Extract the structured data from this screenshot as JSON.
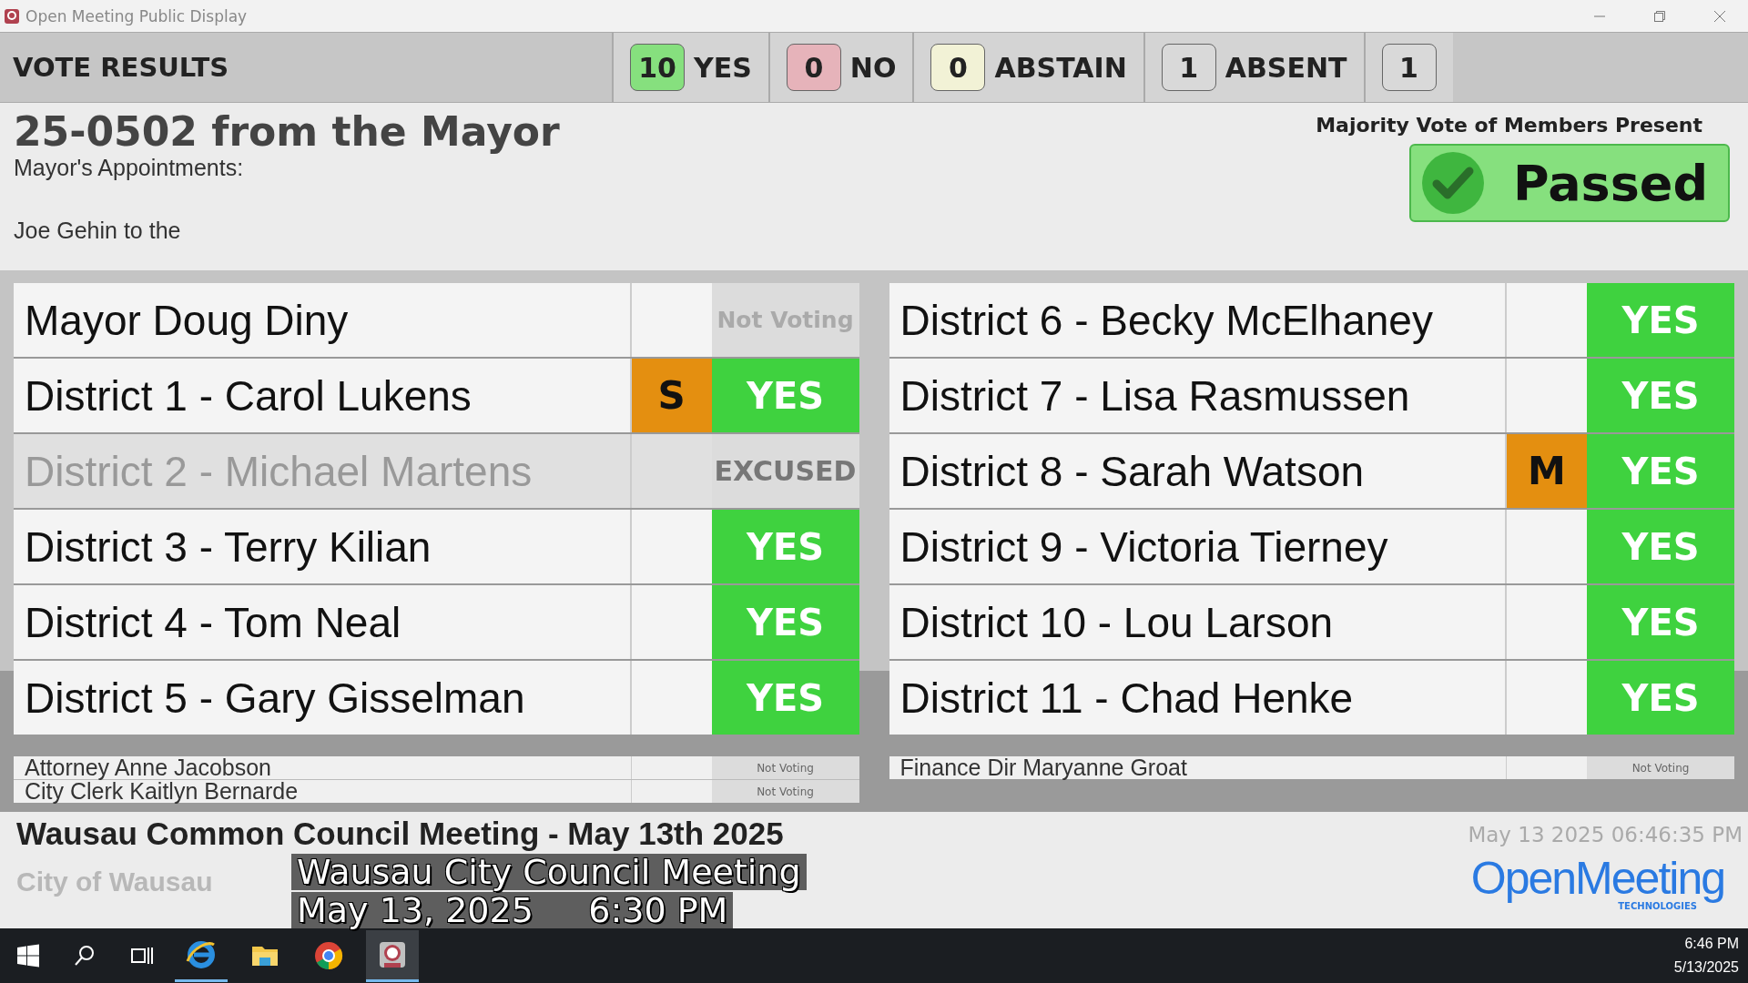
{
  "window": {
    "title": "Open Meeting Public Display"
  },
  "header": {
    "title": "VOTE RESULTS",
    "tallies": [
      {
        "count": "10",
        "label": "YES",
        "color": "#86e07e"
      },
      {
        "count": "0",
        "label": "NO",
        "color": "#e6b3ba"
      },
      {
        "count": "0",
        "label": "ABSTAIN",
        "color": "#f2f2d6"
      },
      {
        "count": "1",
        "label": "ABSENT",
        "color": "#d9d9d9"
      },
      {
        "count": "1",
        "color": "#d9d9d9"
      }
    ]
  },
  "item": {
    "number": "25-0502 from the Mayor",
    "lines": [
      "Mayor's Appointments:",
      "Joe Gehin to the"
    ],
    "rule": "Majority Vote of Members Present",
    "result": "Passed"
  },
  "columns": [
    [
      {
        "name": "Mayor Doug Diny",
        "vote": "Not Voting",
        "kind": "not_voting",
        "present": true
      },
      {
        "name": "District 1 - Carol Lukens",
        "role": "S",
        "vote": "YES",
        "kind": "yes",
        "present": true
      },
      {
        "name": "District 2 - Michael Martens",
        "vote": "EXCUSED",
        "kind": "excused",
        "present": false
      },
      {
        "name": "District 3 - Terry Kilian",
        "vote": "YES",
        "kind": "yes",
        "present": true
      },
      {
        "name": "District 4 - Tom Neal",
        "vote": "YES",
        "kind": "yes",
        "present": true
      },
      {
        "name": "District 5 - Gary Gisselman",
        "vote": "YES",
        "kind": "yes",
        "present": true
      }
    ],
    [
      {
        "name": "District 6 - Becky McElhaney",
        "vote": "YES",
        "kind": "yes",
        "present": true
      },
      {
        "name": "District 7 - Lisa Rasmussen",
        "vote": "YES",
        "kind": "yes",
        "present": true
      },
      {
        "name": "District 8 - Sarah Watson",
        "role": "M",
        "vote": "YES",
        "kind": "yes",
        "present": true
      },
      {
        "name": "District 9 - Victoria Tierney",
        "vote": "YES",
        "kind": "yes",
        "present": true
      },
      {
        "name": "District 10 - Lou Larson",
        "vote": "YES",
        "kind": "yes",
        "present": true
      },
      {
        "name": "District 11 - Chad Henke",
        "vote": "YES",
        "kind": "yes",
        "present": true
      }
    ]
  ],
  "staff": [
    [
      {
        "name": "Attorney Anne Jacobson",
        "vote": "Not Voting"
      },
      {
        "name": "City Clerk Kaitlyn Bernarde",
        "vote": "Not Voting"
      }
    ],
    [
      {
        "name": "Finance Dir Maryanne Groat",
        "vote": "Not Voting"
      }
    ]
  ],
  "footer": {
    "meeting": "Wausau Common Council Meeting - May 13th 2025",
    "org": "City of Wausau",
    "timestamp": "May 13 2025 06:46:35 PM",
    "brand": "OpenMeeting",
    "brand_sub": "TECHNOLOGIES"
  },
  "caption": [
    "Wausau City Council Meeting",
    "May 13, 2025     6:30 PM"
  ],
  "taskbar": {
    "time": "6:46 PM",
    "date": "5/13/2025"
  }
}
